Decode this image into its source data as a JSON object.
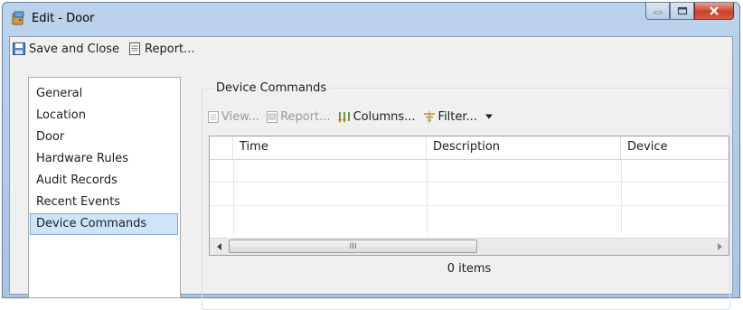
{
  "window": {
    "title": "Edit - Door"
  },
  "toolbar": {
    "save_close": "Save and Close",
    "report": "Report..."
  },
  "nav": {
    "items": [
      {
        "label": "General"
      },
      {
        "label": "Location"
      },
      {
        "label": "Door"
      },
      {
        "label": "Hardware Rules"
      },
      {
        "label": "Audit Records"
      },
      {
        "label": "Recent Events"
      },
      {
        "label": "Device Commands"
      }
    ],
    "selected": "Device Commands"
  },
  "panel": {
    "title": "Device Commands",
    "commands": {
      "view": "View...",
      "report": "Report...",
      "columns": "Columns...",
      "filter": "Filter..."
    },
    "columns": [
      "Time",
      "Description",
      "Device"
    ],
    "status": "0 items",
    "scroll_grip": "III"
  }
}
